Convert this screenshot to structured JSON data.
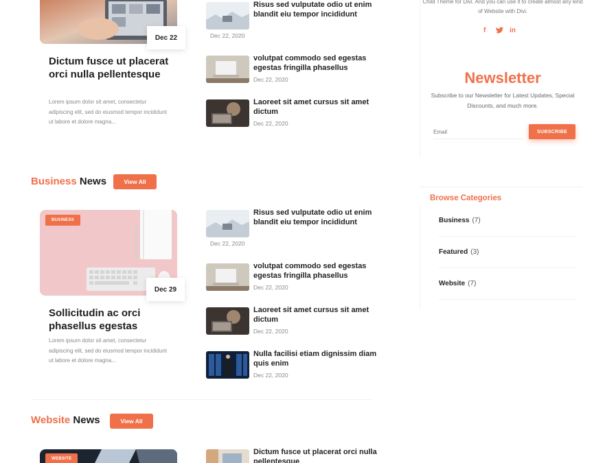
{
  "colors": {
    "accent": "#f0704a"
  },
  "top_featured": {
    "date": "Dec 22",
    "title": "Dictum fusce ut placerat orci nulla pellentesque",
    "excerpt": "Lorem ipsum dolor sit amet, consectetur adipiscing elit, sed do eiusmod tempor incididunt ut labore et dolore magna..."
  },
  "top_posts": [
    {
      "title": "Risus sed vulputate odio ut enim blandit eiu tempor incididunt",
      "date": "Dec 22, 2020"
    },
    {
      "title": "volutpat commodo sed egestas egestas fringilla phasellus",
      "date": "Dec 22, 2020"
    },
    {
      "title": "Laoreet sit amet cursus sit amet dictum",
      "date": "Dec 22, 2020"
    }
  ],
  "business": {
    "heading_accent": "Business",
    "heading_rest": "News",
    "view_all": "View All",
    "featured": {
      "badge": "BUSINESS",
      "date": "Dec 29",
      "title": "Sollicitudin ac orci phasellus egestas",
      "excerpt": "Lorem ipsum dolor sit amet, consectetur adipiscing elit, sed do eiusmod tempor incididunt ut labore et dolore magna..."
    },
    "posts": [
      {
        "title": "Risus sed vulputate odio ut enim blandit eiu tempor incididunt",
        "date": "Dec 22, 2020"
      },
      {
        "title": "volutpat commodo sed egestas egestas fringilla phasellus",
        "date": "Dec 22, 2020"
      },
      {
        "title": "Laoreet sit amet cursus sit amet dictum",
        "date": "Dec 22, 2020"
      },
      {
        "title": "Nulla facilisi etiam dignissim diam quis enim",
        "date": "Dec 22, 2020"
      }
    ]
  },
  "website": {
    "heading_accent": "Website",
    "heading_rest": "News",
    "view_all": "View All",
    "featured": {
      "badge": "WEBSITE"
    },
    "posts": [
      {
        "title": "Dictum fusce ut placerat orci nulla pellentesque"
      }
    ]
  },
  "sidebar": {
    "about_text": "Child Theme for Divi. And you can use it to create almost any kind of Website with Divi.",
    "social": [
      "facebook-icon",
      "twitter-icon",
      "linkedin-icon"
    ],
    "newsletter": {
      "title": "Newsletter",
      "text": "Subscribe to our Newsletter for Latest Updates, Special Discounts, and much more.",
      "email_placeholder": "Email",
      "button": "SUBSCRIBE"
    },
    "categories": {
      "title": "Browse Categories",
      "items": [
        {
          "name": "Business",
          "count": "(7)"
        },
        {
          "name": "Featured",
          "count": "(3)"
        },
        {
          "name": "Website",
          "count": "(7)"
        }
      ]
    }
  }
}
